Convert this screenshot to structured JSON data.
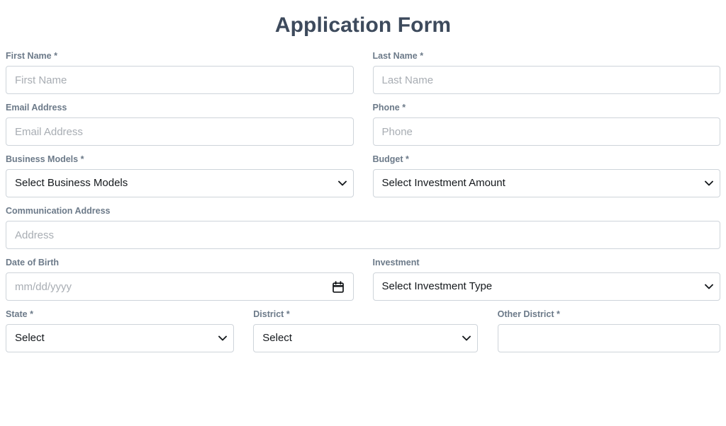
{
  "form": {
    "title": "Application Form",
    "required_marker": "*",
    "colors": {
      "title": "#3d4a5c",
      "label": "#6c7a89",
      "border": "#ced4da",
      "placeholder": "#a8adb3",
      "value_text": "#14181c",
      "background": "#ffffff"
    },
    "rows": {
      "row1": {
        "first_name": {
          "label": "First Name",
          "required": "*",
          "placeholder": "First Name",
          "value": ""
        },
        "last_name": {
          "label": "Last Name",
          "required": "*",
          "placeholder": "Last Name",
          "value": ""
        }
      },
      "row2": {
        "email": {
          "label": "Email Address",
          "required": "",
          "placeholder": "Email Address",
          "value": ""
        },
        "phone": {
          "label": "Phone",
          "required": "*",
          "placeholder": "Phone",
          "value": ""
        }
      },
      "row3": {
        "business_models": {
          "label": "Business Models",
          "required": "*",
          "selected": "Select Business Models",
          "icon": "chevron-down-icon"
        },
        "budget": {
          "label": "Budget",
          "required": "*",
          "selected": "Select Investment Amount",
          "icon": "chevron-down-icon"
        }
      },
      "row4": {
        "communication_address": {
          "label": "Communication Address",
          "required": "",
          "placeholder": "Address",
          "value": ""
        }
      },
      "row5": {
        "date_of_birth": {
          "label": "Date of Birth",
          "required": "",
          "placeholder": "mm/dd/yyyy",
          "value": "",
          "icon": "calendar-icon"
        },
        "investment": {
          "label": "Investment",
          "required": "",
          "selected": "Select Investment Type",
          "icon": "chevron-down-icon"
        }
      },
      "row6": {
        "state": {
          "label": "State",
          "required": "*",
          "selected": "Select",
          "icon": "chevron-down-icon"
        },
        "district": {
          "label": "District",
          "required": "*",
          "selected": "Select",
          "icon": "chevron-down-icon"
        },
        "other_district": {
          "label": "Other District",
          "required": "*",
          "placeholder": "",
          "value": ""
        }
      }
    }
  }
}
